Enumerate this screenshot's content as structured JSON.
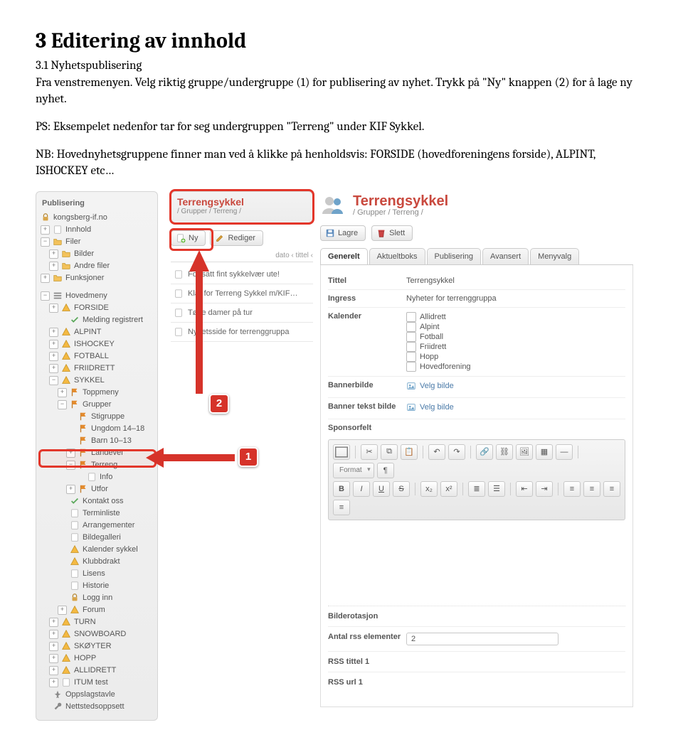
{
  "doc": {
    "h1": "3 Editering av innhold",
    "h2": "3.1 Nyhetspublisering",
    "p1": "Fra venstremenyen. Velg riktig gruppe/undergruppe (1) for publisering av nyhet. Trykk på \"Ny\" knappen (2) for å lage ny nyhet.",
    "p2": "PS: Eksempelet nedenfor tar for seg undergruppen \"Terreng\" under KIF Sykkel.",
    "p3": "NB: Hovednyhetsgruppene finner man ved å klikke på henholdsvis: FORSIDE (hovedforeningens forside), ALPINT, ISHOCKEY etc…"
  },
  "sidebar": {
    "title": "Publisering",
    "root": "kongsberg-if.no",
    "innhold": "Innhold",
    "filer": "Filer",
    "bilder": "Bilder",
    "andre": "Andre filer",
    "funksjoner": "Funksjoner",
    "hovedmeny": "Hovedmeny",
    "forside": "FORSIDE",
    "melding": "Melding registrert",
    "alpint": "ALPINT",
    "ishockey": "ISHOCKEY",
    "fotball": "FOTBALL",
    "friidrett": "FRIIDRETT",
    "sykkel": "SYKKEL",
    "toppmeny": "Toppmeny",
    "grupper": "Grupper",
    "stigruppe": "Stigruppe",
    "ungdom": "Ungdom 14–18",
    "barn": "Barn 10–13",
    "landevei": "Landevei",
    "terreng": "Terreng",
    "info": "Info",
    "utfor": "Utfor",
    "kontakt": "Kontakt oss",
    "terminliste": "Terminliste",
    "arrangementer": "Arrangementer",
    "bildegalleri": "Bildegalleri",
    "kalender": "Kalender sykkel",
    "klubbdrakt": "Klubbdrakt",
    "lisens": "Lisens",
    "historie": "Historie",
    "logginn": "Logg inn",
    "forum": "Forum",
    "turn": "TURN",
    "snowboard": "SNOWBOARD",
    "skoyter": "SKØYTER",
    "hopp": "HOPP",
    "allidrett": "ALLIDRETT",
    "itum": "ITUM test",
    "oppslag": "Oppslagstavle",
    "nettsted": "Nettstedsoppsett"
  },
  "middle": {
    "crumb_title": "Terrengsykkel",
    "crumb_path": "/ Grupper / Terreng /",
    "btn_ny": "Ny",
    "btn_rediger": "Rediger",
    "sort": "dato ‹ tittel ‹",
    "news": [
      "Fortsatt fint sykkelvær ute!",
      "Klar for Terreng Sykkel m/KIF…",
      "Tøffe damer på tur",
      "Nyhetsside for terrenggruppa"
    ]
  },
  "right": {
    "title": "Terrengsykkel",
    "path": "/ Grupper / Terreng /",
    "btn_lagre": "Lagre",
    "btn_slett": "Slett",
    "tabs": [
      "Generelt",
      "Aktueltboks",
      "Publisering",
      "Avansert",
      "Menyvalg"
    ],
    "tittel_lab": "Tittel",
    "tittel_val": "Terrengsykkel",
    "ingress_lab": "Ingress",
    "ingress_val": "Nyheter for terrenggruppa",
    "kalender_lab": "Kalender",
    "kalender_opts": [
      "Allidrett",
      "Alpint",
      "Fotball",
      "Friidrett",
      "Hopp",
      "Hovedforening"
    ],
    "banner_lab": "Bannerbilde",
    "bannertxt_lab": "Banner tekst bilde",
    "velg_bilde": "Velg bilde",
    "sponsor_lab": "Sponsorfelt",
    "format": "Format",
    "rotasjon_lab": "Bilderotasjon",
    "rss_num_lab": "Antal rss elementer",
    "rss_num_val": "2",
    "rss_t1_lab": "RSS tittel 1",
    "rss_u1_lab": "RSS url 1"
  },
  "badge1": "1",
  "badge2": "2"
}
